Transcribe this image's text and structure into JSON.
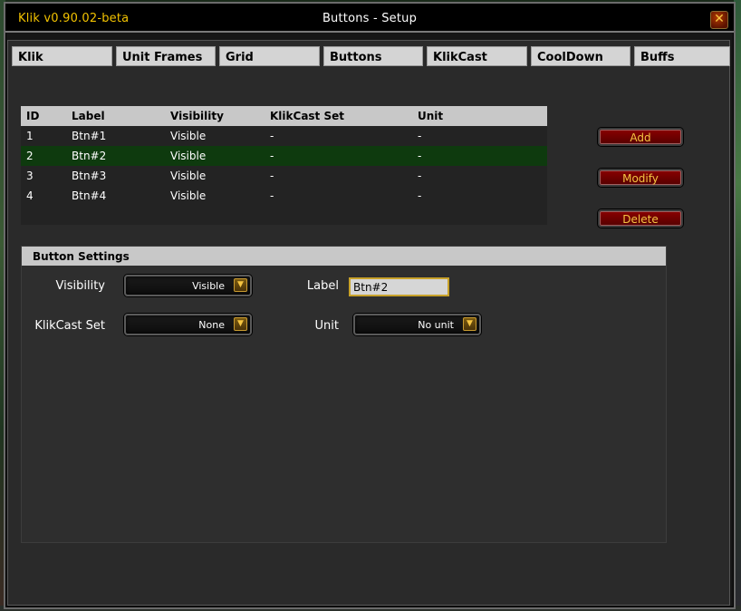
{
  "window": {
    "app_version": "Klik v0.90.02-beta",
    "title": "Buttons - Setup",
    "close_icon": "close-icon"
  },
  "tabs": [
    {
      "label": "Klik"
    },
    {
      "label": "Unit Frames"
    },
    {
      "label": "Grid"
    },
    {
      "label": "Buttons"
    },
    {
      "label": "KlikCast"
    },
    {
      "label": "CoolDown"
    },
    {
      "label": "Buffs"
    }
  ],
  "table": {
    "headers": [
      "ID",
      "Label",
      "Visibility",
      "KlikCast Set",
      "Unit"
    ],
    "rows": [
      {
        "id": "1",
        "label": "Btn#1",
        "visibility": "Visible",
        "klikcast_set": "-",
        "unit": "-"
      },
      {
        "id": "2",
        "label": "Btn#2",
        "visibility": "Visible",
        "klikcast_set": "-",
        "unit": "-"
      },
      {
        "id": "3",
        "label": "Btn#3",
        "visibility": "Visible",
        "klikcast_set": "-",
        "unit": "-"
      },
      {
        "id": "4",
        "label": "Btn#4",
        "visibility": "Visible",
        "klikcast_set": "-",
        "unit": "-"
      }
    ],
    "selected_row": 2
  },
  "actions": {
    "add": "Add",
    "modify": "Modify",
    "delete": "Delete"
  },
  "settings": {
    "header": "Button Settings",
    "visibility_label": "Visibility",
    "visibility_value": "Visible",
    "label_label": "Label",
    "label_value": "Btn#2",
    "klikcast_label": "KlikCast Set",
    "klikcast_value": "None",
    "unit_label": "Unit",
    "unit_value": "No unit"
  },
  "colors": {
    "title_gold": "#f2c200",
    "selected_row": "#0e3a0e",
    "button_red": "#8a0000",
    "button_text": "#f5c542"
  }
}
